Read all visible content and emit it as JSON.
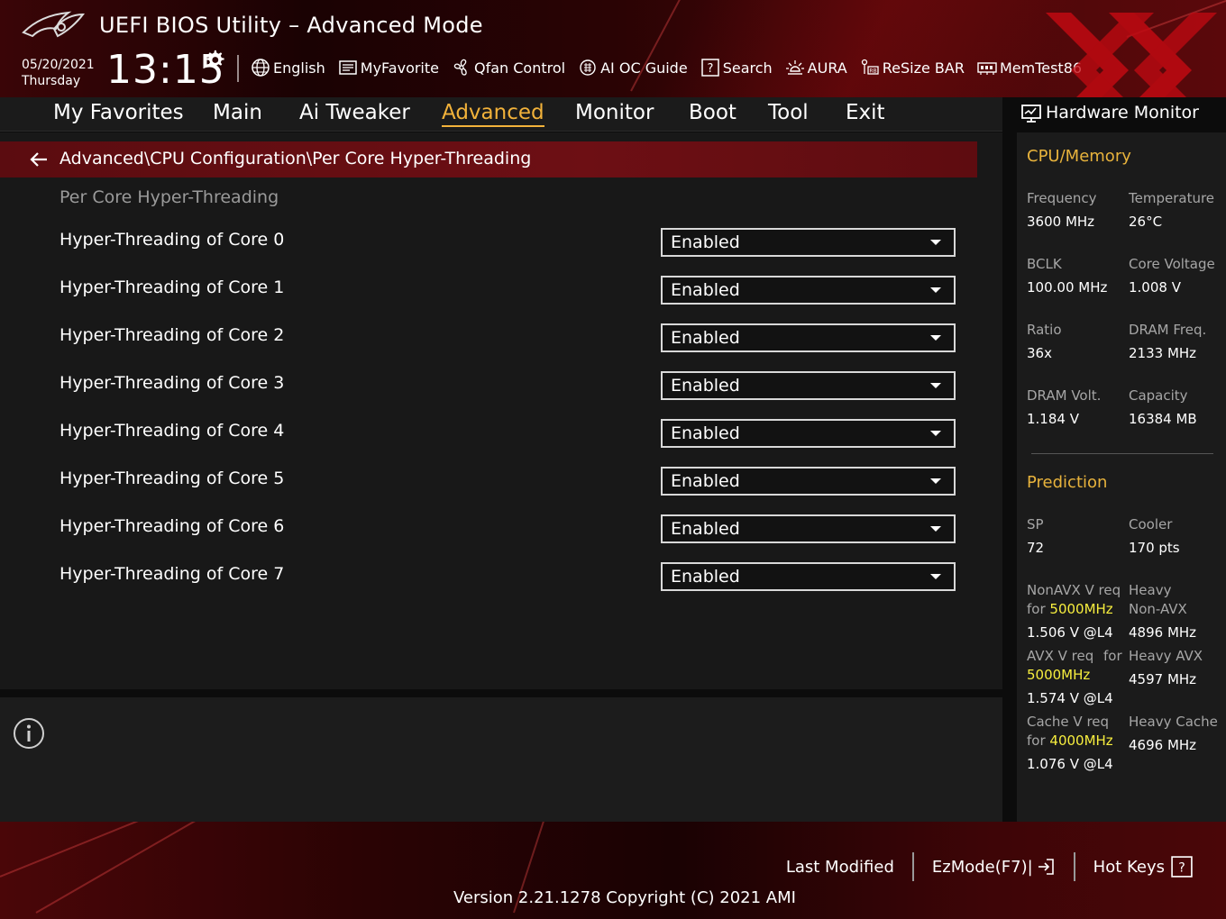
{
  "header": {
    "title": "UEFI BIOS Utility – Advanced Mode",
    "date": "05/20/2021",
    "day": "Thursday",
    "time": "13:15"
  },
  "toolbar": [
    {
      "label": "English",
      "icon": "globe-icon"
    },
    {
      "label": "MyFavorite",
      "icon": "favorite-list-icon"
    },
    {
      "label": "Qfan Control",
      "icon": "fan-icon"
    },
    {
      "label": "AI OC Guide",
      "icon": "ai-chip-icon"
    },
    {
      "label": "Search",
      "icon": "question-search-icon"
    },
    {
      "label": "AURA",
      "icon": "aura-light-icon"
    },
    {
      "label": "ReSize BAR",
      "icon": "resize-bar-icon"
    },
    {
      "label": "MemTest86",
      "icon": "memory-icon"
    }
  ],
  "tabs": [
    {
      "label": "My Favorites",
      "active": false
    },
    {
      "label": "Main",
      "active": false
    },
    {
      "label": "Ai Tweaker",
      "active": false
    },
    {
      "label": "Advanced",
      "active": true
    },
    {
      "label": "Monitor",
      "active": false
    },
    {
      "label": "Boot",
      "active": false
    },
    {
      "label": "Tool",
      "active": false
    },
    {
      "label": "Exit",
      "active": false
    }
  ],
  "breadcrumb": "Advanced\\CPU Configuration\\Per Core Hyper-Threading",
  "section_label": "Per Core Hyper-Threading",
  "settings": [
    {
      "label": "Hyper-Threading of Core 0",
      "value": "Enabled"
    },
    {
      "label": "Hyper-Threading of Core 1",
      "value": "Enabled"
    },
    {
      "label": "Hyper-Threading of Core 2",
      "value": "Enabled"
    },
    {
      "label": "Hyper-Threading of Core 3",
      "value": "Enabled"
    },
    {
      "label": "Hyper-Threading of Core 4",
      "value": "Enabled"
    },
    {
      "label": "Hyper-Threading of Core 5",
      "value": "Enabled"
    },
    {
      "label": "Hyper-Threading of Core 6",
      "value": "Enabled"
    },
    {
      "label": "Hyper-Threading of Core 7",
      "value": "Enabled"
    }
  ],
  "hw_monitor": {
    "title": "Hardware Monitor",
    "cpu_memory_title": "CPU/Memory",
    "frequency_label": "Frequency",
    "frequency_value": "3600 MHz",
    "temperature_label": "Temperature",
    "temperature_value": "26°C",
    "bclk_label": "BCLK",
    "bclk_value": "100.00 MHz",
    "core_voltage_label": "Core Voltage",
    "core_voltage_value": "1.008 V",
    "ratio_label": "Ratio",
    "ratio_value": "36x",
    "dram_freq_label": "DRAM Freq.",
    "dram_freq_value": "2133 MHz",
    "dram_volt_label": "DRAM Volt.",
    "dram_volt_value": "1.184 V",
    "capacity_label": "Capacity",
    "capacity_value": "16384 MB",
    "prediction_title": "Prediction",
    "sp_label": "SP",
    "sp_value": "72",
    "cooler_label": "Cooler",
    "cooler_value": "170 pts",
    "nonavx_label_1": "NonAVX V req",
    "nonavx_label_2_prefix": "for ",
    "nonavx_freq": "5000MHz",
    "nonavx_value": "1.506 V @L4",
    "heavy_nonavx_label_1": "Heavy",
    "heavy_nonavx_label_2": "Non-AVX",
    "heavy_nonavx_value": "4896 MHz",
    "avx_label_1": "AVX V req",
    "avx_label_for": "for",
    "avx_freq": "5000MHz",
    "avx_value": "1.574 V @L4",
    "heavy_avx_label": "Heavy AVX",
    "heavy_avx_value": "4597 MHz",
    "cache_label_1": "Cache V req",
    "cache_label_2_prefix": "for ",
    "cache_freq": "4000MHz",
    "cache_value": "1.076 V @L4",
    "heavy_cache_label": "Heavy Cache",
    "heavy_cache_value": "4696 MHz"
  },
  "footer": {
    "last_modified": "Last Modified",
    "ezmode": "EzMode(F7)|",
    "hot_keys": "Hot Keys",
    "version": "Version 2.21.1278 Copyright (C) 2021 AMI"
  },
  "colors": {
    "accent": "#f2b23a",
    "highlight": "#f7ee3e",
    "breadcrumb_bg": "#6d0f14"
  }
}
